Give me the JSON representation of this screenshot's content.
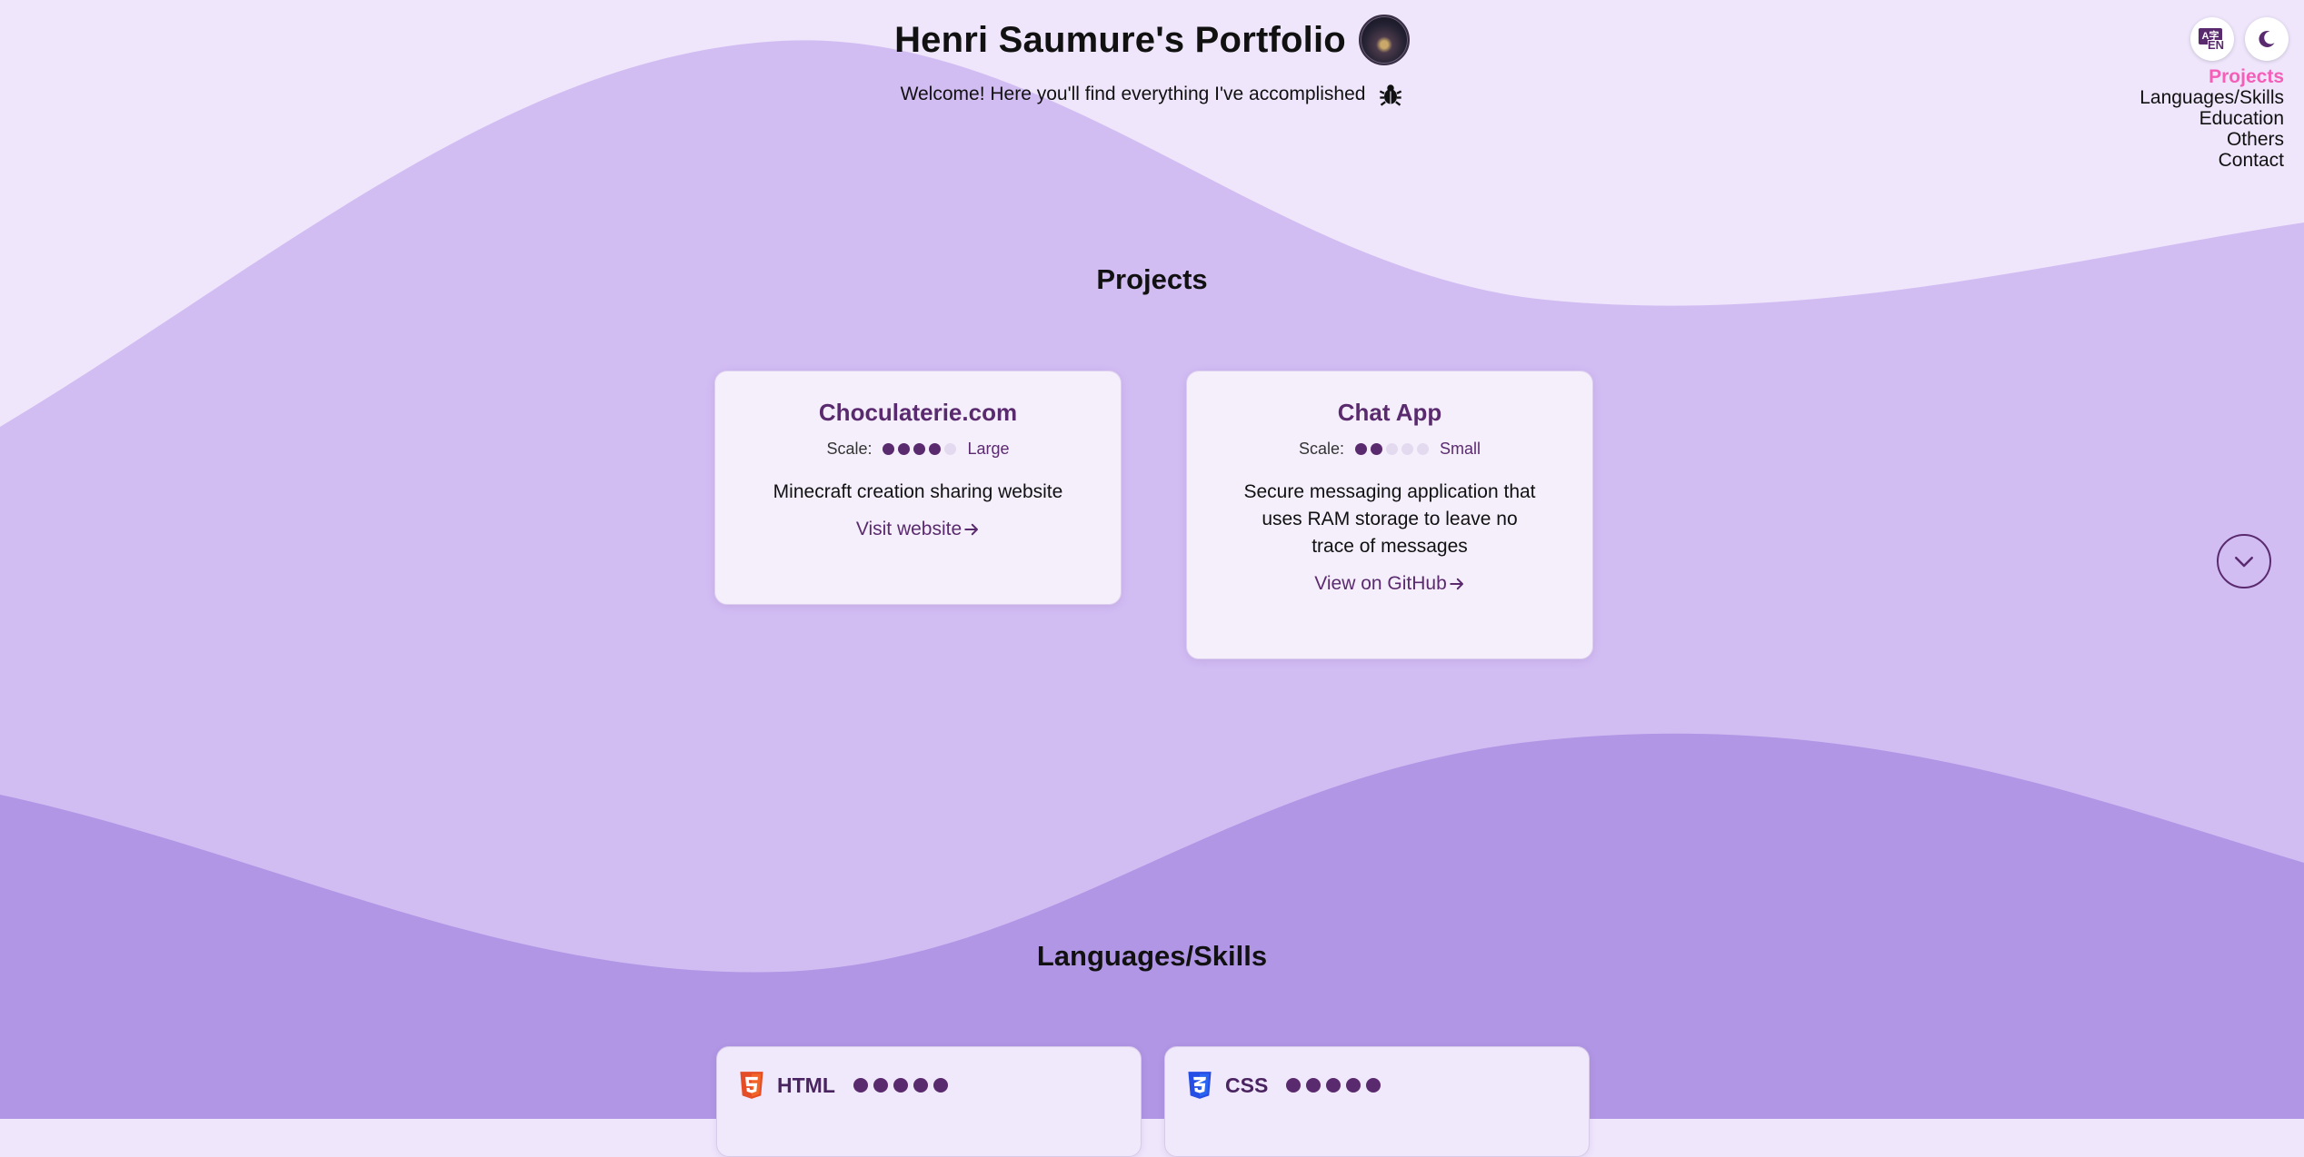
{
  "header": {
    "title": "Henri Saumure's Portfolio",
    "subtitle": "Welcome! Here you'll find everything I've accomplished"
  },
  "controls": {
    "language_icon": "translate-icon",
    "language_code": "EN",
    "language_glyph": "A字",
    "theme_icon": "moon-icon"
  },
  "nav": {
    "items": [
      "Projects",
      "Languages/Skills",
      "Education",
      "Others",
      "Contact"
    ],
    "active": "Projects"
  },
  "sections": {
    "projects_title": "Projects",
    "skills_title": "Languages/Skills"
  },
  "projects": [
    {
      "title": "Choculaterie.com",
      "scale_label": "Scale:",
      "scale_level": 4,
      "scale_max": 5,
      "scale_word": "Large",
      "description": "Minecraft creation sharing website",
      "link_label": "Visit website"
    },
    {
      "title": "Chat App",
      "scale_label": "Scale:",
      "scale_level": 2,
      "scale_max": 5,
      "scale_word": "Small",
      "description": "Secure messaging application that uses RAM storage to leave no trace of messages",
      "link_label": "View on GitHub"
    }
  ],
  "skills": [
    {
      "name": "HTML",
      "icon": "html5-icon",
      "level": 5,
      "max": 5
    },
    {
      "name": "CSS",
      "icon": "css3-icon",
      "level": 5,
      "max": 5
    }
  ],
  "colors": {
    "accent": "#5a2a6e",
    "nav_active": "#f45fb8",
    "bg_light": "#efe6fc",
    "wave_mid": "#d2bdf3",
    "wave_dark": "#b196e5",
    "html_orange": "#e44d26",
    "css_blue": "#264de4"
  }
}
